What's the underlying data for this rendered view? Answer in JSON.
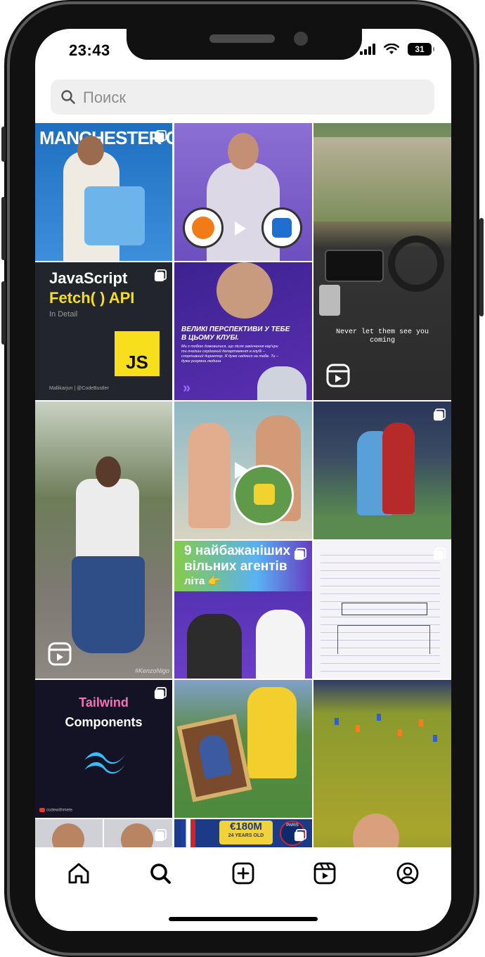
{
  "status_bar": {
    "time": "23:43",
    "battery": "31"
  },
  "search": {
    "placeholder": "Поиск"
  },
  "posts": {
    "p1": {
      "headline": "MANCHESTER CI"
    },
    "p4": {
      "line1": "JavaScript",
      "line2": "Fetch( ) API",
      "line3": "In Detail",
      "badge": "JS",
      "credit": "Mallikarjun | @CodeBustler"
    },
    "p5": {
      "title": "ВЕЛИКІ ПЕРСПЕКТИВИ У ТЕБЕ В ЦЬОМУ КЛУБІ.",
      "body": "Ми з тобою домовилися, що після закінчення кар'єри ти очолиш серйозний департамент в клубі – спортивний директор. Я дуже надіюся на тебе. Ти – дуже розумна людина"
    },
    "p6": {
      "caption_line1": "Never let them see you",
      "caption_line2": "coming"
    },
    "p7": {
      "watermark": "#KenzoNigo"
    },
    "p10": {
      "line1": "9 найбажаніших",
      "line2": "вільних агентів",
      "line3": "літа 👉"
    },
    "p13": {
      "line1": "Tailwind",
      "line2": "Components",
      "credit": "codewithmete"
    },
    "p17": {
      "price": "€180M",
      "sub": "24 YEARS OLD",
      "club": "PARIS"
    }
  },
  "nav": {
    "items": [
      "home",
      "search",
      "create",
      "reels",
      "profile"
    ],
    "active": "search"
  },
  "colors": {
    "accent_yellow": "#f7df1e",
    "tailwind_pink": "#f472b6",
    "tailwind_cyan": "#38bdf8",
    "purple": "#6a3fc7"
  }
}
